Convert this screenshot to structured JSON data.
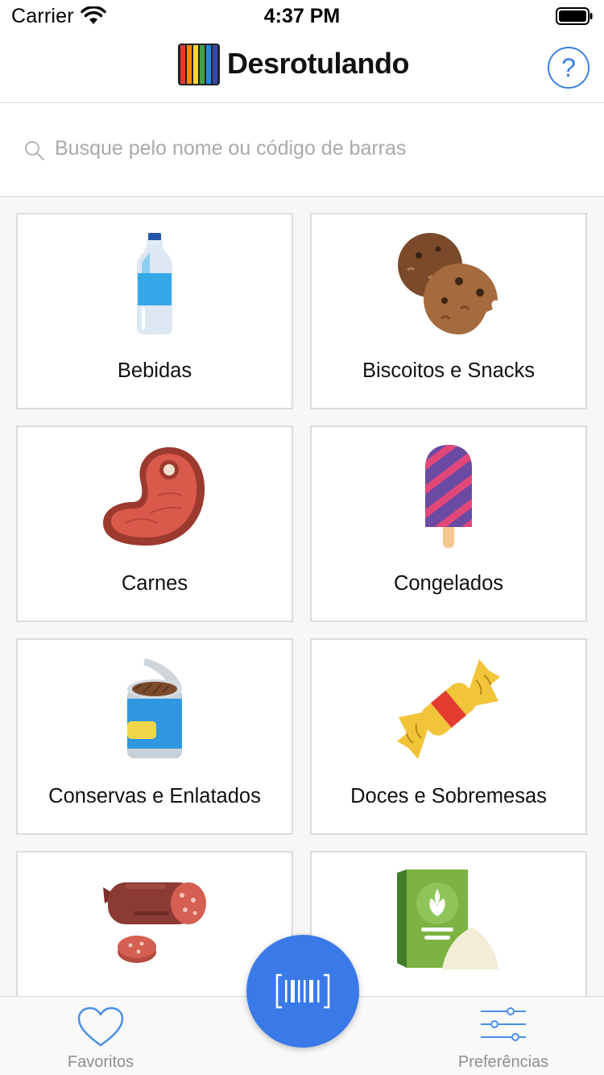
{
  "status": {
    "carrier": "Carrier",
    "time": "4:37 PM"
  },
  "header": {
    "title": "Desrotulando",
    "help": "?"
  },
  "search": {
    "placeholder": "Busque pelo nome ou código de barras"
  },
  "categories": [
    {
      "label": "Bebidas",
      "icon": "water-bottle-icon"
    },
    {
      "label": "Biscoitos e Snacks",
      "icon": "cookies-icon"
    },
    {
      "label": "Carnes",
      "icon": "steak-icon"
    },
    {
      "label": "Congelados",
      "icon": "popsicle-icon"
    },
    {
      "label": "Conservas e Enlatados",
      "icon": "canned-food-icon"
    },
    {
      "label": "Doces e Sobremesas",
      "icon": "candy-icon"
    },
    {
      "label": "",
      "icon": "salami-icon"
    },
    {
      "label": "",
      "icon": "grain-bag-icon"
    }
  ],
  "tabs": {
    "favorites": {
      "label": "Favoritos",
      "icon": "heart-icon"
    },
    "scan": {
      "icon": "barcode-icon"
    },
    "preferences": {
      "label": "Preferências",
      "icon": "sliders-icon"
    }
  },
  "colors": {
    "accent": "#3a7ae8",
    "tab_text": "#8e8e93"
  }
}
